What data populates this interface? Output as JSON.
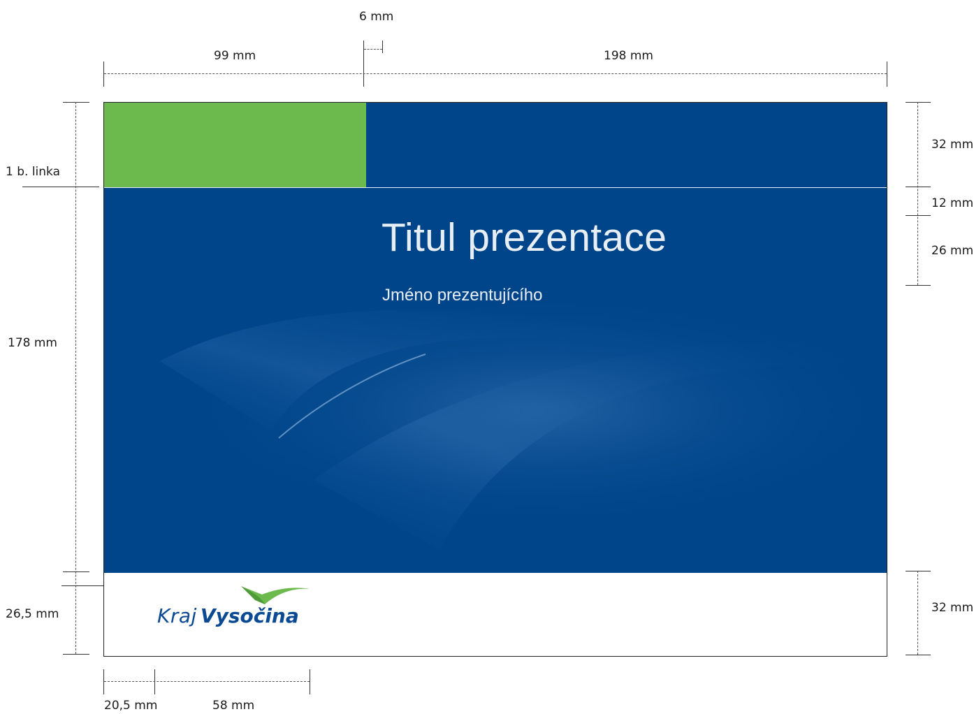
{
  "dimensions": {
    "top_gap": "6 mm",
    "top_left_width": "99 mm",
    "top_right_width": "198 mm",
    "right_top_height": "32 mm",
    "right_gap": "12 mm",
    "right_title_height": "26 mm",
    "right_bottom_height": "32 mm",
    "left_line": "1 b. linka",
    "left_main_height": "178 mm",
    "left_bottom_height": "26,5 mm",
    "bottom_margin": "20,5 mm",
    "bottom_logo_width": "58 mm"
  },
  "slide": {
    "title": "Titul prezentace",
    "subtitle": "Jméno prezentujícího",
    "colors": {
      "primary_blue": "#00458a",
      "accent_green": "#6cb94e",
      "text_light": "#e8eef6"
    }
  },
  "logo": {
    "word1": "Kraj",
    "word2": "Vysočina",
    "icon": "swoosh-logo-icon"
  }
}
